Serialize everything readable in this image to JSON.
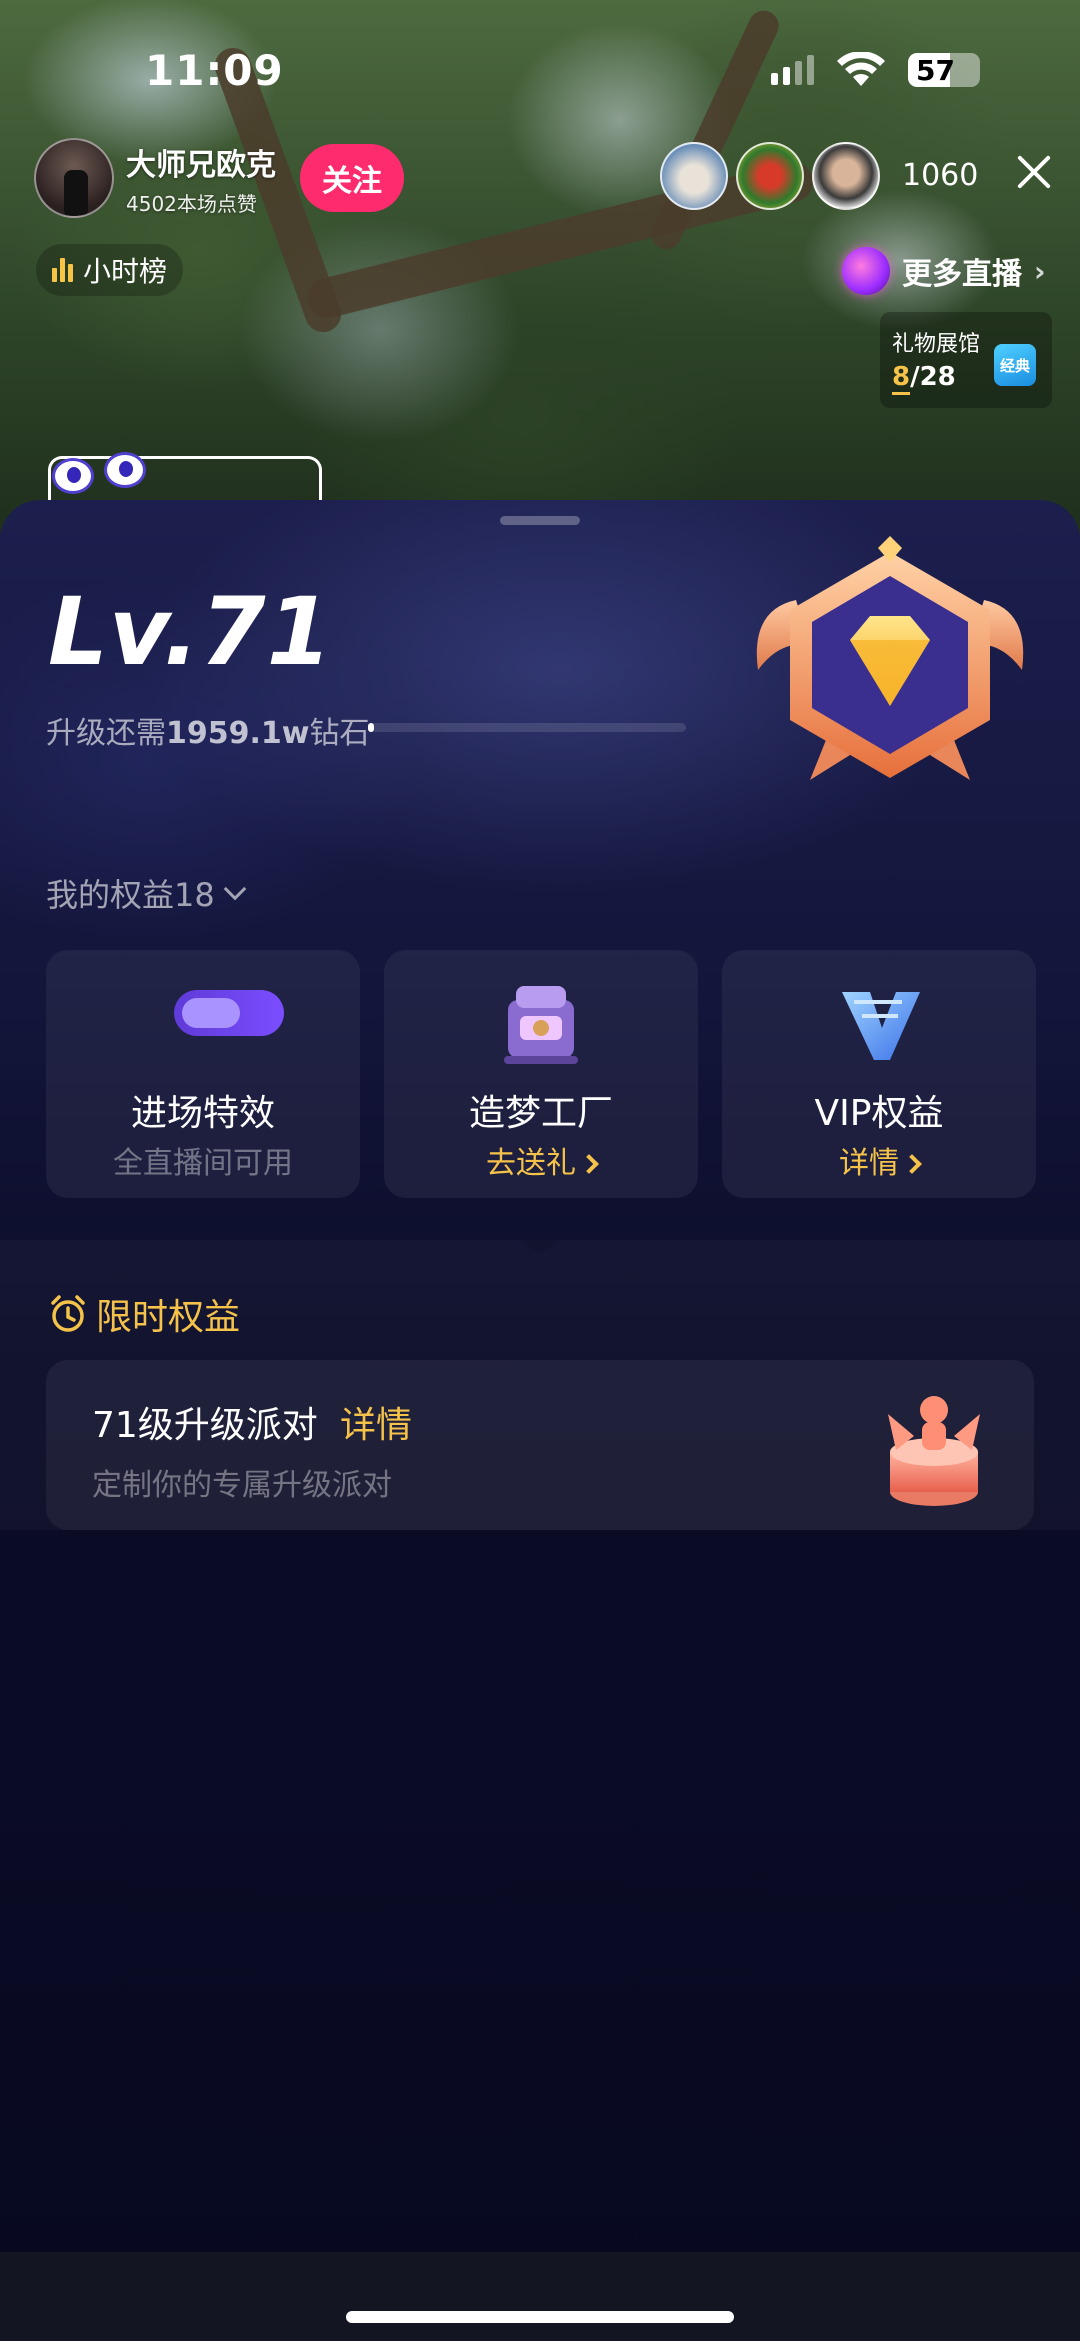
{
  "status_bar": {
    "time": "11:09",
    "battery": "57"
  },
  "live_header": {
    "host_name": "大师兄欧克",
    "host_likes": "4502本场点赞",
    "follow_label": "关注",
    "viewer_count": "1060",
    "hour_rank_label": "小时榜",
    "more_live_label": "更多直播",
    "gift_hall": {
      "title": "礼物展馆",
      "current": "8",
      "total": "/28",
      "badge": "经典"
    }
  },
  "level_sheet": {
    "level": "Lv.71",
    "upgrade_prefix": "升级还需",
    "upgrade_amount": "1959.1w",
    "upgrade_suffix": "钻石",
    "progress_fraction": 0.02,
    "my_rights_label": "我的权益18",
    "rights_cards": [
      {
        "title": "进场特效",
        "subtitle": "全直播间可用",
        "icon": "entrance-effect-icon"
      },
      {
        "title": "造梦工厂",
        "subtitle": "去送礼",
        "icon": "dream-factory-icon"
      },
      {
        "title": "VIP权益",
        "subtitle": "详情",
        "icon": "vip-icon"
      }
    ],
    "limited": {
      "section_title": "限时权益",
      "party_title": "71级升级派对",
      "party_detail": "详情",
      "party_subtitle": "定制你的专属升级派对"
    }
  },
  "colors": {
    "accent_gold": "#f5c24a",
    "follow_pink": "#fe2c6e",
    "sheet_bg": "#0b0c27"
  }
}
